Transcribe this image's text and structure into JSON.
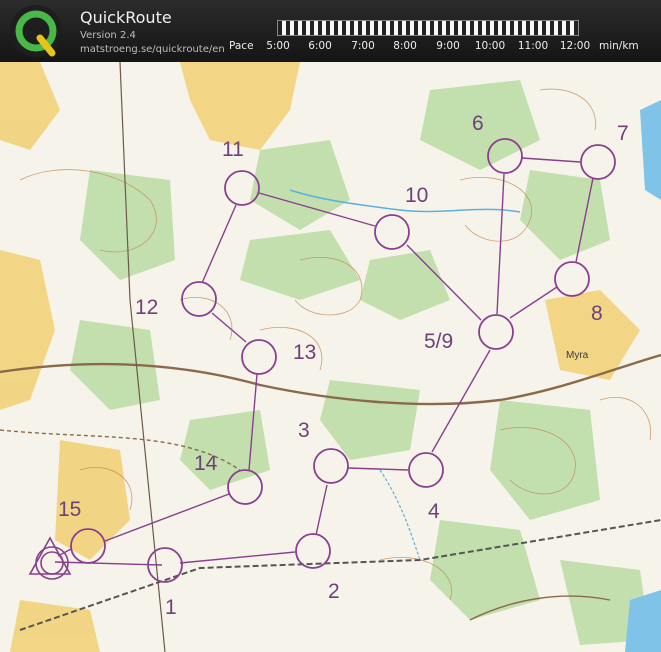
{
  "app": {
    "name": "QuickRoute",
    "version": "Version 2.4",
    "url": "matstroeng.se/quickroute/en",
    "logo_icon": "quickroute-q-logo-icon",
    "logo_color": "#49b848"
  },
  "pace_scale": {
    "label": "Pace",
    "ticks": [
      "5:00",
      "6:00",
      "7:00",
      "8:00",
      "9:00",
      "10:00",
      "11:00",
      "12:00"
    ],
    "unit": "min/km"
  },
  "course": {
    "line_color": "#8a3f8e",
    "controls": [
      {
        "label": "1"
      },
      {
        "label": "2"
      },
      {
        "label": "3"
      },
      {
        "label": "4"
      },
      {
        "label": "5/9"
      },
      {
        "label": "6"
      },
      {
        "label": "7"
      },
      {
        "label": "8"
      },
      {
        "label": "10"
      },
      {
        "label": "11"
      },
      {
        "label": "12"
      },
      {
        "label": "13"
      },
      {
        "label": "14"
      },
      {
        "label": "15"
      }
    ]
  },
  "map": {
    "place_names": [
      "Myra"
    ]
  }
}
